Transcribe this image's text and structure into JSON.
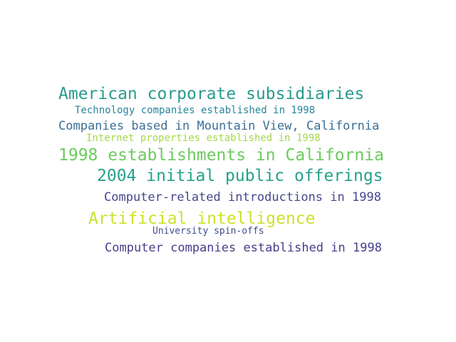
{
  "words": [
    {
      "text": "American corporate subsidiaries",
      "color": "#2a9a8e"
    },
    {
      "text": "Technology companies established in 1998",
      "color": "#26869a"
    },
    {
      "text": "Companies based in Mountain View, California",
      "color": "#3a6f94"
    },
    {
      "text": "Internet properties established in 1998",
      "color": "#a6d84a"
    },
    {
      "text": "1998 establishments in California",
      "color": "#6ccb5f"
    },
    {
      "text": "2004 initial public offerings",
      "color": "#25a18a"
    },
    {
      "text": "Computer-related introductions in 1998",
      "color": "#46478c"
    },
    {
      "text": "Artificial intelligence",
      "color": "#cde12c"
    },
    {
      "text": "University spin-offs",
      "color": "#3f4b8c"
    },
    {
      "text": "Computer companies established in 1998",
      "color": "#433f8a"
    }
  ]
}
